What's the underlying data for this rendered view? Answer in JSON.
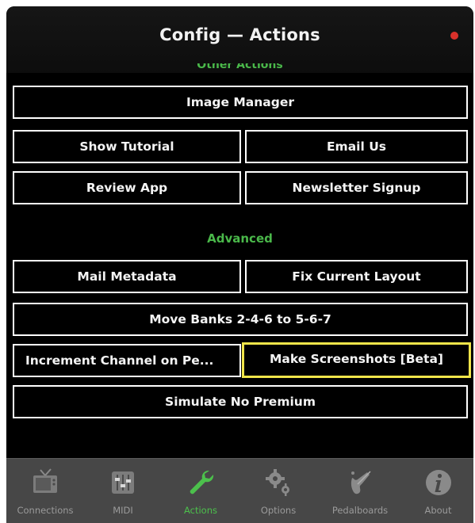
{
  "header": {
    "title": "Config — Actions",
    "section_cut": "Other Actions"
  },
  "buttons": {
    "image_manager": "Image Manager",
    "show_tutorial": "Show Tutorial",
    "email_us": "Email Us",
    "review_app": "Review App",
    "newsletter_signup": "Newsletter Signup",
    "mail_metadata": "Mail Metadata",
    "fix_current_layout": "Fix Current Layout",
    "move_banks": "Move Banks 2-4-6 to 5-6-7",
    "increment_channel": "Increment Channel on Pe...",
    "make_screenshots": "Make Screenshots [Beta]",
    "simulate_no_premium": "Simulate No Premium"
  },
  "sections": {
    "advanced": "Advanced"
  },
  "colors": {
    "accent_green": "#4cc04c",
    "highlight_yellow": "#f0e54a",
    "status_red": "#d9312b"
  },
  "tabbar": {
    "active": "Actions",
    "tabs": [
      {
        "label": "Connections",
        "icon": "tv-icon"
      },
      {
        "label": "MIDI",
        "icon": "midi-sliders-icon"
      },
      {
        "label": "Actions",
        "icon": "wrench-icon"
      },
      {
        "label": "Options",
        "icon": "gears-icon"
      },
      {
        "label": "Pedalboards",
        "icon": "guitar-icon"
      },
      {
        "label": "About",
        "icon": "info-icon"
      }
    ]
  }
}
